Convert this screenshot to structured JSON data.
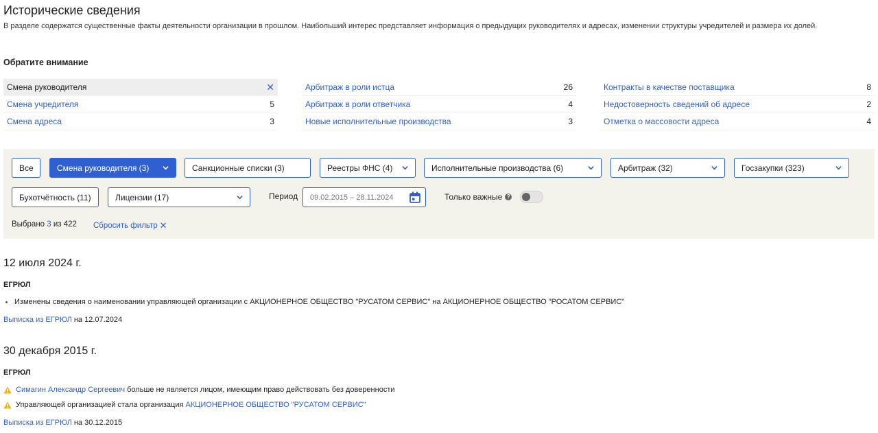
{
  "page": {
    "title": "Исторические сведения",
    "description": "В разделе содержатся существенные факты деятельности организации в прошлом. Наибольший интерес представляет информация о предыдущих руководителях и адресах, изменении структуры учредителей и размера их долей.",
    "notice_heading": "Обратите внимание"
  },
  "facts": {
    "col1": [
      {
        "label": "Смена руководителя",
        "count": "",
        "active": true
      },
      {
        "label": "Смена учредителя",
        "count": "5"
      },
      {
        "label": "Смена адреса",
        "count": "3"
      }
    ],
    "col2": [
      {
        "label": "Арбитраж в роли истца",
        "count": "26"
      },
      {
        "label": "Арбитраж в роли ответчика",
        "count": "4"
      },
      {
        "label": "Новые исполнительные производства",
        "count": "3"
      }
    ],
    "col3": [
      {
        "label": "Контракты в качестве поставщика",
        "count": "8"
      },
      {
        "label": "Недостоверность сведений об адресе",
        "count": "2"
      },
      {
        "label": "Отметка о массовости адреса",
        "count": "4"
      }
    ]
  },
  "filters": {
    "chips": [
      {
        "label": "Все"
      },
      {
        "label": "Смена руководителя (3)"
      },
      {
        "label": "Санкционные списки (3)"
      },
      {
        "label": "Реестры ФНС (4)"
      },
      {
        "label": "Исполнительные производства (6)"
      },
      {
        "label": "Арбитраж (32)"
      },
      {
        "label": "Госзакупки (323)"
      },
      {
        "label": "Бухотчётность (11)"
      },
      {
        "label": "Лицензии (17)"
      }
    ],
    "period_label": "Период",
    "period_value": "09.02.2015 – 28.11.2024",
    "important_label": "Только важные",
    "selected_prefix": "Выбрано",
    "selected_count": "3",
    "selected_suffix": "из 422",
    "reset_label": "Сбросить фильтр",
    "colors": {
      "accent": "#2f5fd0",
      "panel": "#f3f3ec",
      "warning": "#f2b310"
    }
  },
  "events": [
    {
      "date": "12 июля 2024 г.",
      "source": "ЕГРЮЛ",
      "lines": [
        {
          "text": "Изменены сведения о наименовании управляющей организации с АКЦИОНЕРНОЕ ОБЩЕСТВО \"РУСАТОМ СЕРВИС\" на АКЦИОНЕРНОЕ ОБЩЕСТВО \"РОСАТОМ СЕРВИС\""
        }
      ],
      "extract_link": "Выписка из ЕГРЮЛ",
      "extract_date": "на 12.07.2024"
    },
    {
      "date": "30 декабря 2015 г.",
      "source": "ЕГРЮЛ",
      "lines": [
        {
          "link": "Симагин Александр Сергеевич",
          "text": "больше не является лицом, имеющим право действовать без доверенности"
        },
        {
          "text": "Управляющей организацией стала организация",
          "link": "АКЦИОНЕРНОЕ ОБЩЕСТВО \"РУСАТОМ СЕРВИС\""
        }
      ],
      "extract_link": "Выписка из ЕГРЮЛ",
      "extract_date": "на 30.12.2015"
    }
  ],
  "icons": {
    "warning": "warning-icon",
    "calendar": "calendar-icon",
    "info": "info-icon",
    "close": "close-icon",
    "chevron": "chevron-down-icon"
  }
}
